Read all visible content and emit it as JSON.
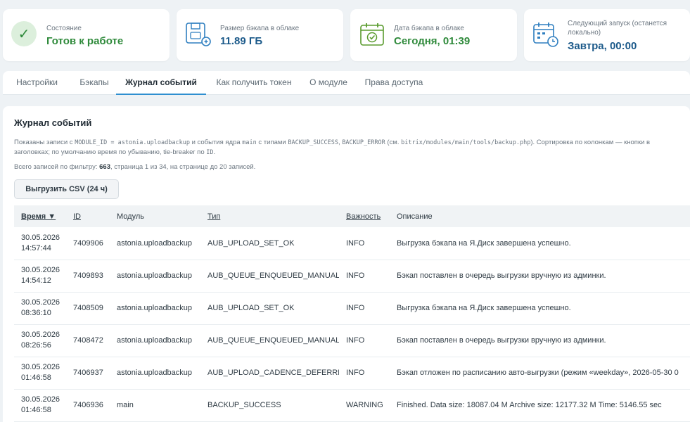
{
  "cards": {
    "status": {
      "label": "Состояние",
      "value": "Готов к работе"
    },
    "size": {
      "label": "Размер бэкапа в облаке",
      "value": "11.89 ГБ"
    },
    "date": {
      "label": "Дата бэкапа в облаке",
      "value": "Сегодня, 01:39"
    },
    "next": {
      "label": "Следующий запуск (останется локально)",
      "value": "Завтра, 00:00"
    }
  },
  "tabs": [
    "Настройки",
    "Бэкапы",
    "Журнал событий",
    "Как получить токен",
    "О модуле",
    "Права доступа"
  ],
  "active_tab": "Журнал событий",
  "journal": {
    "title": "Журнал событий",
    "desc_1": "Показаны записи с ",
    "desc_code_1": "MODULE_ID = astonia.uploadbackup",
    "desc_2": " и события ядра ",
    "desc_code_2": "main",
    "desc_3": " с типами ",
    "desc_code_3": "BACKUP_SUCCESS",
    "desc_4": ", ",
    "desc_code_4": "BACKUP_ERROR",
    "desc_5": " (см. ",
    "desc_code_5": "bitrix/modules/main/tools/backup.php",
    "desc_6": "). Сортировка по колонкам — кнопки в заголовках; по умолчанию время по убыванию, tie-breaker по ",
    "desc_code_6": "ID",
    "desc_7": ".",
    "count_prefix": "Всего записей по фильтру: ",
    "count_total": "663",
    "count_suffix": ", страница 1 из 34, на странице до 20 записей.",
    "export_label": "Выгрузить CSV (24 ч)",
    "columns": {
      "time": "Время ▼",
      "id": "ID",
      "module": "Модуль",
      "type": "Тип",
      "severity": "Важность",
      "description": "Описание"
    },
    "rows": [
      {
        "date": "30.05.2026",
        "clock": "14:57:44",
        "id": "7409906",
        "module": "astonia.uploadbackup",
        "type": "AUB_UPLOAD_SET_OK",
        "severity": "INFO",
        "description": "Выгрузка бэкапа на Я.Диск завершена успешно."
      },
      {
        "date": "30.05.2026",
        "clock": "14:54:12",
        "id": "7409893",
        "module": "astonia.uploadbackup",
        "type": "AUB_QUEUE_ENQUEUED_MANUAL",
        "severity": "INFO",
        "description": "Бэкап поставлен в очередь выгрузки вручную из админки."
      },
      {
        "date": "30.05.2026",
        "clock": "08:36:10",
        "id": "7408509",
        "module": "astonia.uploadbackup",
        "type": "AUB_UPLOAD_SET_OK",
        "severity": "INFO",
        "description": "Выгрузка бэкапа на Я.Диск завершена успешно."
      },
      {
        "date": "30.05.2026",
        "clock": "08:26:56",
        "id": "7408472",
        "module": "astonia.uploadbackup",
        "type": "AUB_QUEUE_ENQUEUED_MANUAL",
        "severity": "INFO",
        "description": "Бэкап поставлен в очередь выгрузки вручную из админки."
      },
      {
        "date": "30.05.2026",
        "clock": "01:46:58",
        "id": "7406937",
        "module": "astonia.uploadbackup",
        "type": "AUB_UPLOAD_CADENCE_DEFERRED",
        "severity": "INFO",
        "description": "Бэкап отложен по расписанию авто-выгрузки (режим «weekday», 2026-05-30 0"
      },
      {
        "date": "30.05.2026",
        "clock": "01:46:58",
        "id": "7406936",
        "module": "main",
        "type": "BACKUP_SUCCESS",
        "severity": "WARNING",
        "description": "Finished. Data size: 18087.04 M Archive size: 12177.32 M Time: 5146.55 sec"
      }
    ]
  },
  "colors": {
    "success": "#2f8a3b",
    "info_value": "#1c5a8a",
    "tab_accent": "#2f8fd0"
  },
  "icons": {
    "status": "check-circle-icon",
    "size": "cloud-drive-icon",
    "date": "calendar-check-icon",
    "next": "calendar-clock-icon"
  }
}
